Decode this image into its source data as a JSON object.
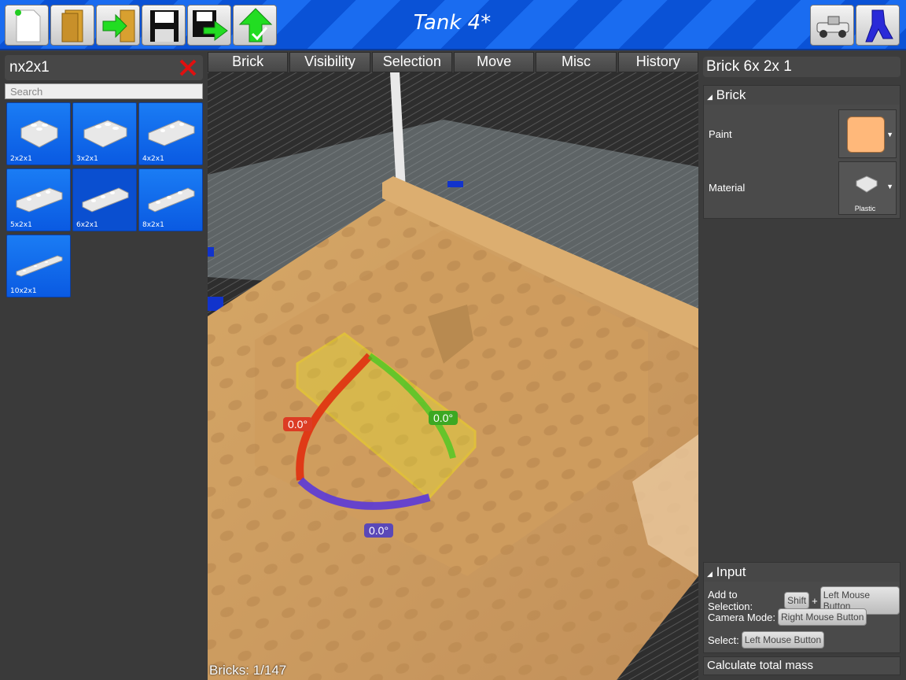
{
  "app": {
    "title": "Tank 4*"
  },
  "toolbar": {
    "left_buttons": [
      "new-file-icon",
      "open-folder-icon",
      "import-icon",
      "save-icon",
      "save-as-icon",
      "upload-icon"
    ],
    "right_buttons": [
      "vehicle-icon",
      "character-icon"
    ]
  },
  "catalog": {
    "filter_text": "nx2x1",
    "search_placeholder": "Search",
    "tiles": [
      {
        "label": "2x2x1",
        "selected": false
      },
      {
        "label": "3x2x1",
        "selected": false
      },
      {
        "label": "4x2x1",
        "selected": false
      },
      {
        "label": "5x2x1",
        "selected": false
      },
      {
        "label": "6x2x1",
        "selected": true
      },
      {
        "label": "8x2x1",
        "selected": false
      },
      {
        "label": "10x2x1",
        "selected": false
      }
    ]
  },
  "tabs": [
    "Brick",
    "Visibility",
    "Selection",
    "Move",
    "Misc",
    "History"
  ],
  "viewport": {
    "bricks_count": "Bricks: 1/147",
    "angle_red": "0.0°",
    "angle_green": "0.0°",
    "angle_blue": "0.0°"
  },
  "inspector": {
    "brick_name": "Brick 6x 2x 1",
    "brick_section": "Brick",
    "paint_label": "Paint",
    "paint_color": "#ffb87a",
    "material_label": "Material",
    "material_value": "Plastic",
    "input_section": "Input",
    "add_to_selection_label": "Add to Selection:",
    "shift_key": "Shift",
    "plus": "+",
    "left_mouse": "Left Mouse Button",
    "camera_mode_label": "Camera Mode:",
    "right_mouse": "Right Mouse Button",
    "select_label": "Select:",
    "select_key": "Left Mouse Button",
    "calc_mass": "Calculate total mass"
  },
  "colors": {
    "accent_blue": "#1a6cf0",
    "panel": "#3c3c3c",
    "selection_yellow": "#ffff00"
  }
}
